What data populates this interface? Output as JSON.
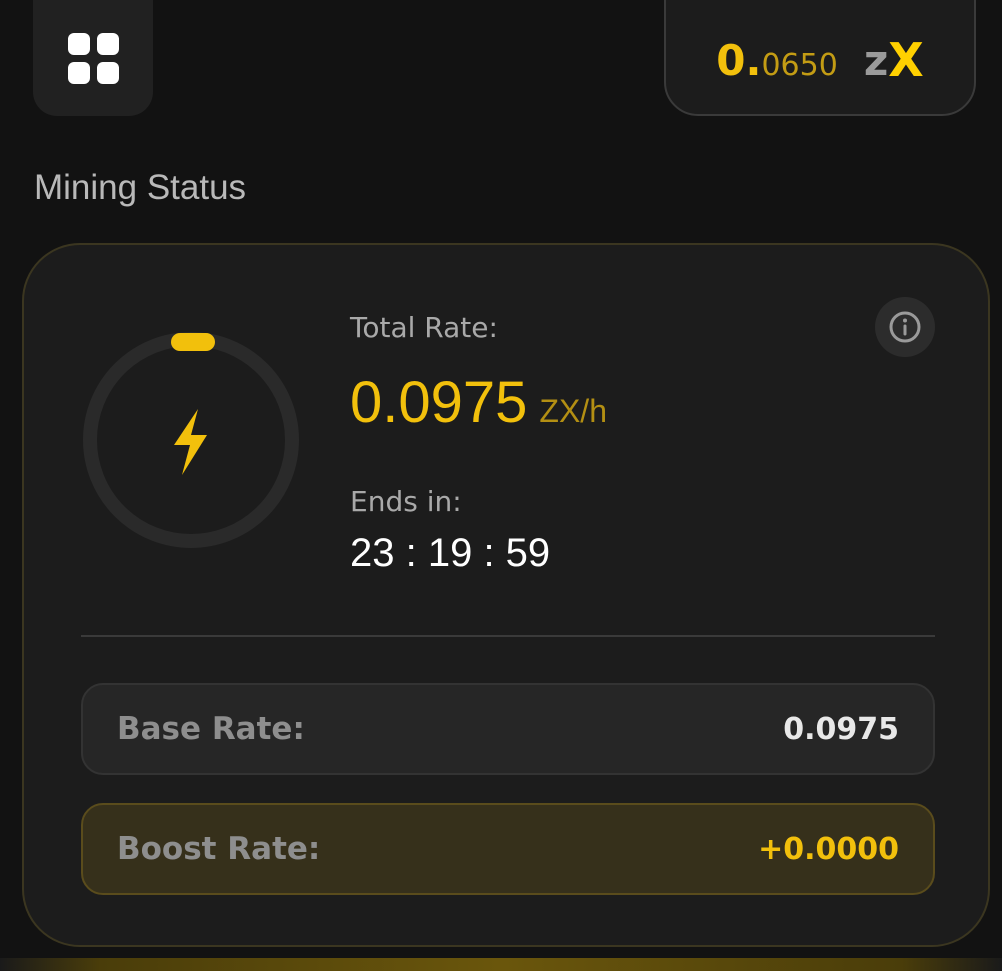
{
  "header": {
    "menu_icon": "grid-icon",
    "balance": {
      "integer": "0.",
      "decimals": "0650",
      "unit_z": "z",
      "unit_x": "X"
    }
  },
  "section_title": "Mining Status",
  "mining": {
    "icon": "lightning-icon",
    "info_icon": "info-icon",
    "total_rate_label": "Total Rate:",
    "total_rate_value": "0.0975",
    "total_rate_unit": "ZX/h",
    "ends_in_label": "Ends in:",
    "countdown": "23 : 19 : 59",
    "progress_percent": 1
  },
  "rates": {
    "base": {
      "label": "Base Rate:",
      "value": "0.0975"
    },
    "boost": {
      "label": "Boost Rate:",
      "value": "+0.0000"
    }
  },
  "colors": {
    "accent": "#f2c00c",
    "background": "#121212",
    "card": "#1c1c1c"
  }
}
